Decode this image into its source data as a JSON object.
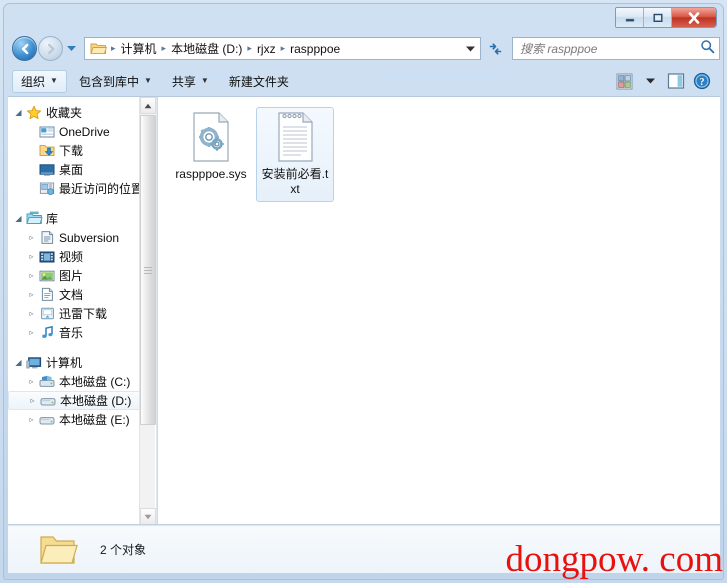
{
  "window": {
    "title": "",
    "buttons": {
      "minimize": "minimize",
      "maximize": "maximize",
      "close": "close"
    }
  },
  "address": {
    "crumbs": [
      "计算机",
      "本地磁盘 (D:)",
      "rjxz",
      "raspppoe"
    ],
    "separator": "▸",
    "dropdown": "▼",
    "refresh_label": "refresh"
  },
  "search": {
    "placeholder": "搜索 raspppoe",
    "value": ""
  },
  "toolbar": {
    "items": [
      {
        "label": "组织",
        "caret": "▼",
        "active": true
      },
      {
        "label": "包含到库中",
        "caret": "▼",
        "active": false
      },
      {
        "label": "共享",
        "caret": "▼",
        "active": false
      },
      {
        "label": "新建文件夹",
        "caret": "",
        "active": false
      }
    ],
    "right_icons": [
      "view-options-icon",
      "view-dropdown-caret",
      "preview-pane-icon",
      "help-icon"
    ],
    "view_caret": "▼"
  },
  "sidebar": {
    "groups": [
      {
        "header": {
          "label": "收藏夹",
          "icon": "star-icon",
          "twisty": "◢"
        },
        "items": [
          {
            "label": "OneDrive",
            "icon": "onedrive-icon",
            "twisty": ""
          },
          {
            "label": "下载",
            "icon": "downloads-icon",
            "twisty": ""
          },
          {
            "label": "桌面",
            "icon": "desktop-icon",
            "twisty": ""
          },
          {
            "label": "最近访问的位置",
            "icon": "recent-places-icon",
            "twisty": ""
          }
        ]
      },
      {
        "header": {
          "label": "库",
          "icon": "library-icon",
          "twisty": "◢"
        },
        "items": [
          {
            "label": "Subversion",
            "icon": "subversion-icon",
            "twisty": "▹"
          },
          {
            "label": "视频",
            "icon": "video-icon",
            "twisty": "▹"
          },
          {
            "label": "图片",
            "icon": "pictures-icon",
            "twisty": "▹"
          },
          {
            "label": "文档",
            "icon": "documents-icon",
            "twisty": "▹"
          },
          {
            "label": "迅雷下载",
            "icon": "thunder-download-icon",
            "twisty": "▹"
          },
          {
            "label": "音乐",
            "icon": "music-icon",
            "twisty": "▹"
          }
        ]
      },
      {
        "header": {
          "label": "计算机",
          "icon": "computer-icon",
          "twisty": "◢"
        },
        "items": [
          {
            "label": "本地磁盘 (C:)",
            "icon": "system-drive-icon",
            "twisty": "▹",
            "selected": false
          },
          {
            "label": "本地磁盘 (D:)",
            "icon": "drive-icon",
            "twisty": "▹",
            "selected": true
          },
          {
            "label": "本地磁盘 (E:)",
            "icon": "drive-icon",
            "twisty": "▹",
            "selected": false
          }
        ]
      }
    ]
  },
  "content": {
    "files": [
      {
        "name": "raspppoe.sys",
        "icon": "sys-file-icon",
        "selected": false
      },
      {
        "name": "安装前必看.txt",
        "icon": "text-file-icon",
        "selected": true
      }
    ]
  },
  "status": {
    "text": "2 个对象",
    "icon": "folder-icon"
  },
  "watermark": {
    "text": "dongpow. com",
    "color": "#e8110f"
  }
}
